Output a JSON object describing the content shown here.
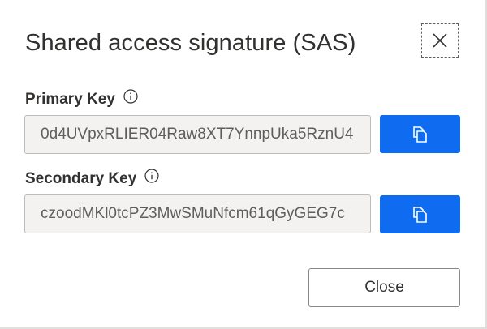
{
  "dialog": {
    "title": "Shared access signature (SAS)",
    "close_icon": "close-icon"
  },
  "primary": {
    "label": "Primary Key",
    "info_icon": "info-icon",
    "value": "0d4UVpxRLIER04Raw8XT7YnnpUka5RznU4",
    "copy_icon": "copy-icon"
  },
  "secondary": {
    "label": "Secondary Key",
    "info_icon": "info-icon",
    "value": "czoodMKl0tcPZ3MwSMuNfcm61qGyGEG7c",
    "copy_icon": "copy-icon"
  },
  "footer": {
    "close_label": "Close"
  },
  "colors": {
    "accent": "#0f6cf0",
    "field_bg": "#f3f2f1",
    "text": "#323130"
  }
}
